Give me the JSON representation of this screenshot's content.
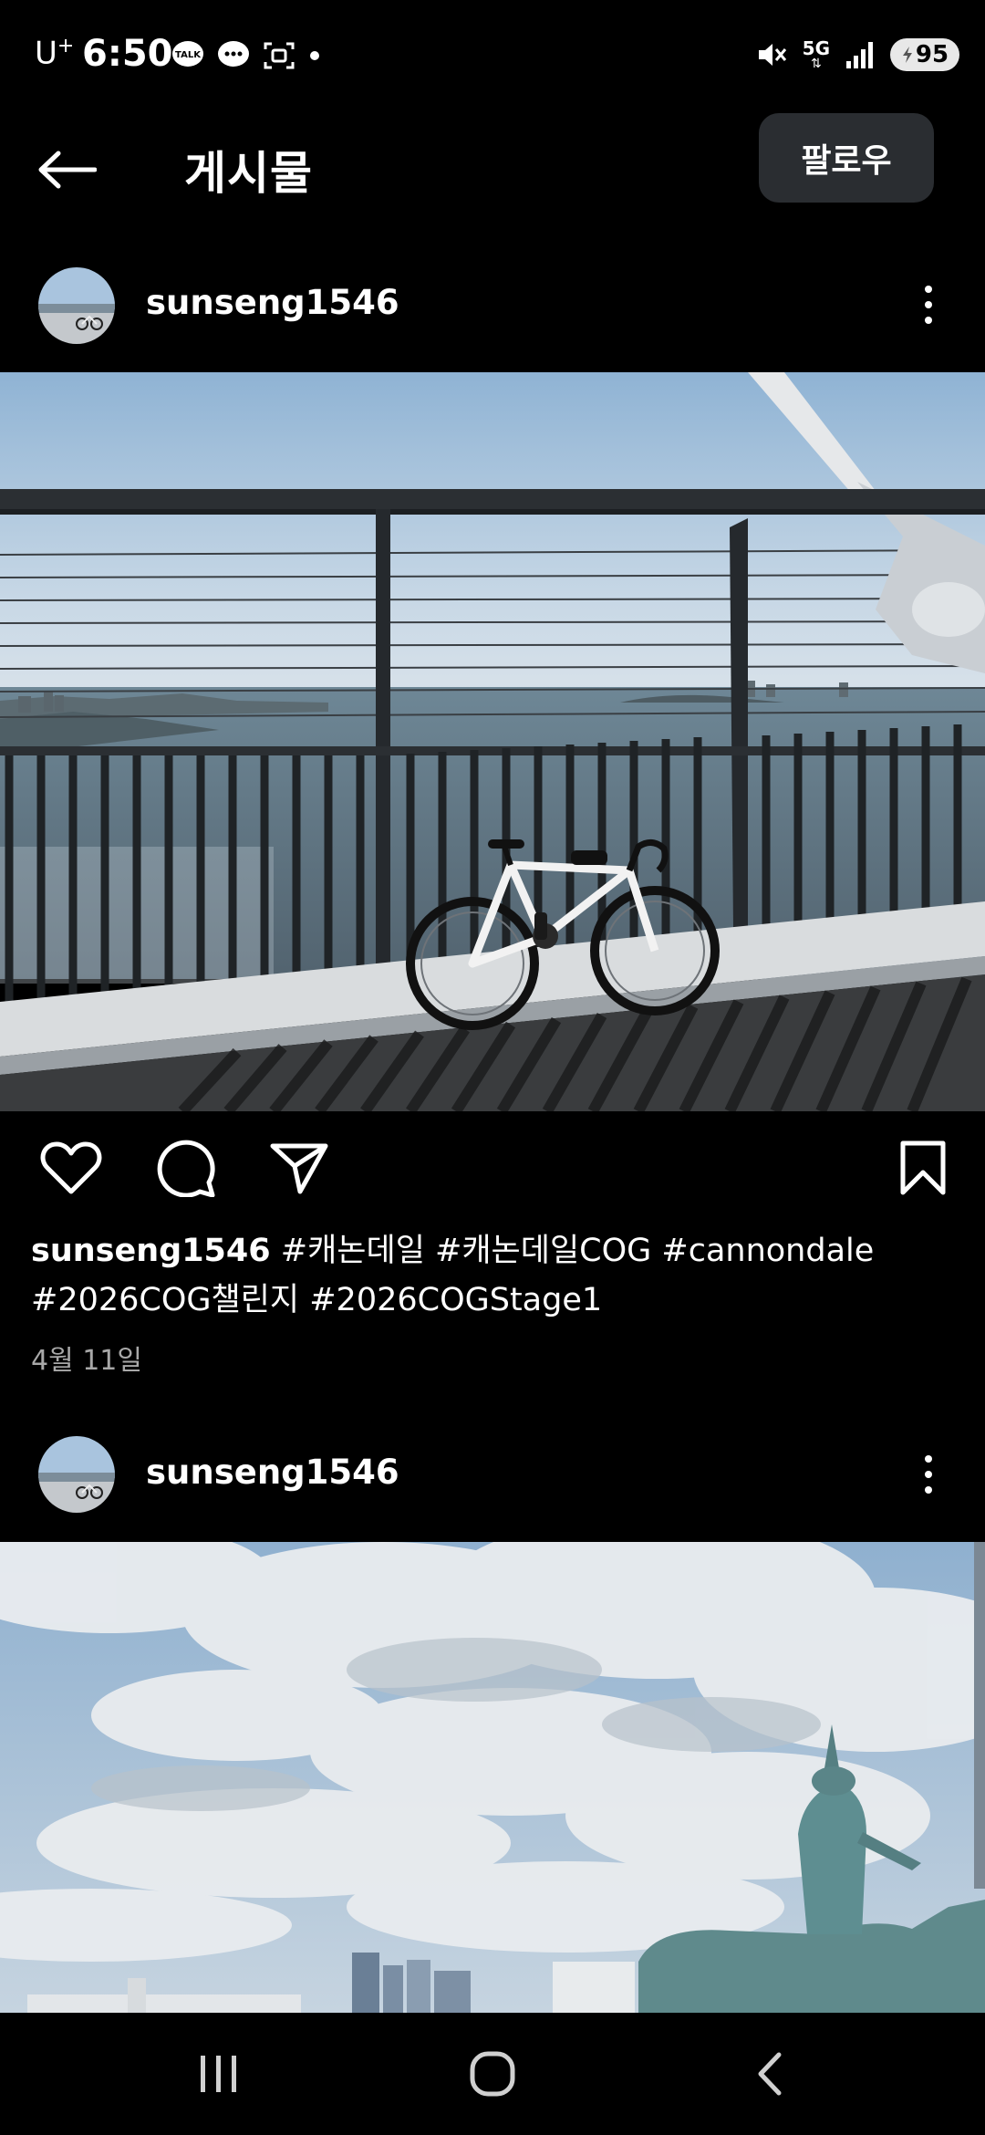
{
  "status_bar": {
    "carrier": "U",
    "carrier_sup": "+",
    "time": "6:50",
    "network": "5G",
    "battery": "95"
  },
  "header": {
    "title": "게시물",
    "follow_label": "팔로우"
  },
  "posts": [
    {
      "username": "sunseng1546",
      "caption": "#캐논데일 #캐논데일COG #cannondale #2026COG챌린지 #2026COGStage1",
      "date": "4월 11일"
    },
    {
      "username": "sunseng1546"
    }
  ],
  "colors": {
    "background": "#000000",
    "follow_button": "#2a2d31",
    "date_text": "#a8a8a8"
  },
  "icons": {
    "back": "arrow-left-icon",
    "more": "more-vertical-icon",
    "like": "heart-icon",
    "comment": "comment-icon",
    "share": "send-icon",
    "save": "bookmark-icon",
    "nav_recents": "recents-icon",
    "nav_home": "home-icon",
    "nav_back": "back-icon"
  }
}
